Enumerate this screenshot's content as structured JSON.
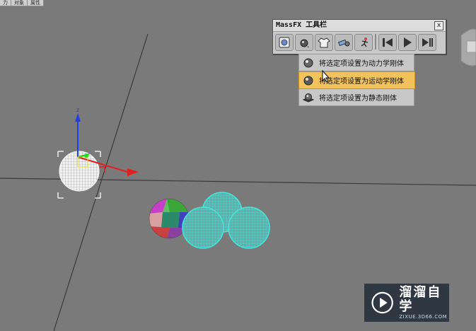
{
  "top_strip": {
    "tabs": [
      "力",
      "对象",
      "属性"
    ]
  },
  "massfx_toolbar": {
    "title": "MassFX 工具栏",
    "close_label": "x",
    "tools": [
      "world-parameters-icon",
      "rigid-body-icon",
      "cloth-icon",
      "constraint-icon",
      "ragdoll-icon",
      "reset-simulation-icon",
      "play-simulation-icon",
      "step-simulation-icon"
    ]
  },
  "rigid_body_menu": {
    "items": [
      {
        "label": "将选定项设置为动力学刚体",
        "icon": "dynamic-rigid-body-icon",
        "highlighted": false
      },
      {
        "label": "将选定项设置为运动学刚体",
        "icon": "kinematic-rigid-body-icon",
        "highlighted": true
      },
      {
        "label": "将选定项设置为静态刚体",
        "icon": "static-rigid-body-icon",
        "highlighted": false
      }
    ]
  },
  "gizmo": {
    "axis_label": "z"
  },
  "colors": {
    "viewport_bg": "#7a7a7a",
    "menu_highlight": "#f2c35d",
    "sphere_cyan": "#3fd7cf",
    "gizmo_red": "#e02020",
    "gizmo_blue": "#2040e0"
  },
  "watermark": {
    "brand": "溜溜自学",
    "site": "ZIXUE.3D66.COM"
  }
}
